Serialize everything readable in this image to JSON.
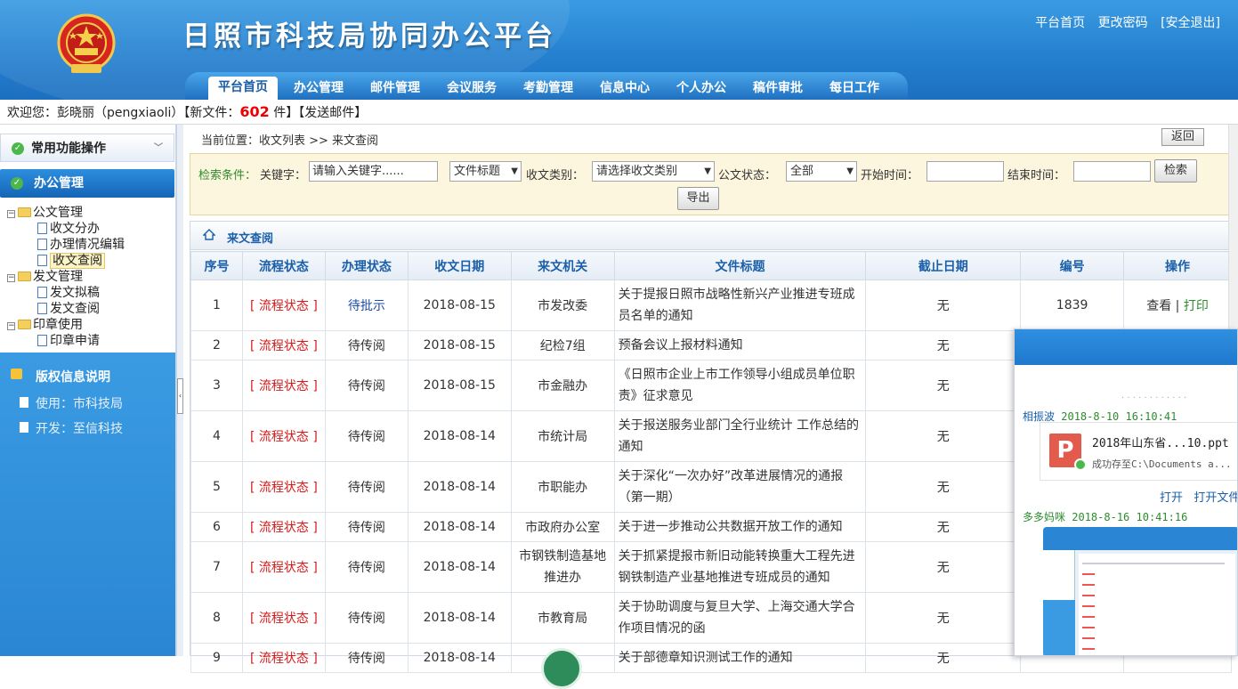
{
  "header": {
    "site_title": "日照市科技局协同办公平台",
    "links": [
      "平台首页",
      "更改密码",
      "[安全退出]"
    ]
  },
  "nav": {
    "tabs": [
      "平台首页",
      "办公管理",
      "邮件管理",
      "会议服务",
      "考勤管理",
      "信息中心",
      "个人办公",
      "稿件审批",
      "每日工作"
    ],
    "active": "平台首页"
  },
  "welcome": {
    "prefix": "欢迎您：彭晓丽（pengxiaoli）【新文件：",
    "count": "602",
    "suffix": " 件】【发送邮件】"
  },
  "sidebar": {
    "common_ops": "常用功能操作",
    "office_mgmt": "办公管理",
    "tree": [
      {
        "label": "公文管理",
        "type": "folder"
      },
      {
        "label": "收文分办",
        "type": "doc"
      },
      {
        "label": "办理情况编辑",
        "type": "doc"
      },
      {
        "label": "收文查阅",
        "type": "doc",
        "selected": true
      },
      {
        "label": "发文管理",
        "type": "folder"
      },
      {
        "label": "发文拟稿",
        "type": "doc"
      },
      {
        "label": "发文查阅",
        "type": "doc"
      },
      {
        "label": "印章使用",
        "type": "folder"
      },
      {
        "label": "印章申请",
        "type": "doc"
      }
    ],
    "copyright_title": "版权信息说明",
    "copyright_use": "使用：市科技局",
    "copyright_dev": "开发：至信科技"
  },
  "main": {
    "breadcrumb": "当前位置：收文列表 >> 来文查阅",
    "back_label": "返回",
    "search": {
      "label": "检索条件：",
      "keyword_label": "关键字：",
      "keyword_placeholder": "请输入关键字......",
      "field_select": "文件标题",
      "type_label": "收文类别：",
      "type_select": "请选择收文类别",
      "status_label": "公文状态：",
      "status_select": "全部",
      "start_label": "开始时间：",
      "end_label": "结束时间：",
      "search_btn": "检索",
      "export_btn": "导出"
    },
    "panel_title": "来文查阅",
    "columns": [
      "序号",
      "流程状态",
      "办理状态",
      "收文日期",
      "来文机关",
      "文件标题",
      "截止日期",
      "编号",
      "操作"
    ],
    "rows": [
      {
        "no": "1",
        "flow": "[ 流程状态 ]",
        "state": "待批示",
        "date": "2018-08-15",
        "org": "市发改委",
        "title": "关于提报日照市战略性新兴产业推进专班成员名单的通知",
        "due": "无",
        "num": "1839",
        "op_view": "查看",
        "op_sep": "|",
        "op_print": "打印"
      },
      {
        "no": "2",
        "flow": "[ 流程状态 ]",
        "state": "待传阅",
        "date": "2018-08-15",
        "org": "纪检7组",
        "title": "预备会议上报材料通知",
        "due": "无"
      },
      {
        "no": "3",
        "flow": "[ 流程状态 ]",
        "state": "待传阅",
        "date": "2018-08-15",
        "org": "市金融办",
        "title": "《日照市企业上市工作领导小组成员单位职责》征求意见",
        "due": "无"
      },
      {
        "no": "4",
        "flow": "[ 流程状态 ]",
        "state": "待传阅",
        "date": "2018-08-14",
        "org": "市统计局",
        "title": "关于报送服务业部门全行业统计 工作总结的通知",
        "due": "无"
      },
      {
        "no": "5",
        "flow": "[ 流程状态 ]",
        "state": "待传阅",
        "date": "2018-08-14",
        "org": "市职能办",
        "title": "关于深化“一次办好”改革进展情况的通报（第一期）",
        "due": "无"
      },
      {
        "no": "6",
        "flow": "[ 流程状态 ]",
        "state": "待传阅",
        "date": "2018-08-14",
        "org": "市政府办公室",
        "title": "关于进一步推动公共数据开放工作的通知",
        "due": "无"
      },
      {
        "no": "7",
        "flow": "[ 流程状态 ]",
        "state": "待传阅",
        "date": "2018-08-14",
        "org": "市钢铁制造基地推进办",
        "title": "关于抓紧提报市新旧动能转换重大工程先进钢铁制造产业基地推进专班成员的通知",
        "due": "无"
      },
      {
        "no": "8",
        "flow": "[ 流程状态 ]",
        "state": "待传阅",
        "date": "2018-08-14",
        "org": "市教育局",
        "title": "关于协助调度与复旦大学、上海交通大学合作项目情况的函",
        "due": "无"
      },
      {
        "no": "9",
        "flow": "[ 流程状态 ]",
        "state": "待传阅",
        "date": "2018-08-14",
        "org": "市",
        "title": "关于部德章知识测试工作的通知",
        "due": "无"
      }
    ]
  },
  "popup": {
    "msg1_user": "相振波",
    "msg1_time": "2018-8-10 16:10:41",
    "file_name": "2018年山东省...10.ppt",
    "file_saved": "成功存至C:\\Documents a...",
    "act_open": "打开",
    "act_open_folder": "打开文件夹",
    "msg2_user": "多多妈咪",
    "msg2_time": "2018-8-16 10:41:16"
  }
}
